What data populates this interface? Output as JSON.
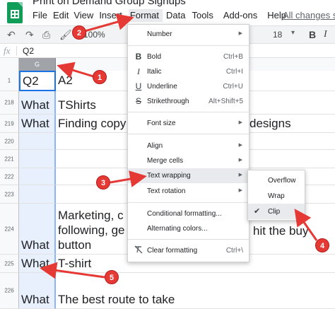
{
  "app": {
    "doc_title": "Print on Demand Group Signups",
    "save_status": "All changes sa",
    "menus": [
      {
        "label": "File",
        "active": false
      },
      {
        "label": "Edit",
        "active": false
      },
      {
        "label": "View",
        "active": false
      },
      {
        "label": "Insert",
        "active": false
      },
      {
        "label": "Format",
        "active": true
      },
      {
        "label": "Data",
        "active": false
      },
      {
        "label": "Tools",
        "active": false
      },
      {
        "label": "Add-ons",
        "active": false
      },
      {
        "label": "Help",
        "active": false
      }
    ]
  },
  "toolbar": {
    "zoom": "100%",
    "font_size": "18",
    "bold_label": "B",
    "italic_label": "I"
  },
  "formula_bar": {
    "fx": "fx",
    "value": "Q2"
  },
  "sheet": {
    "selected_column": "G",
    "rows": [
      {
        "num": "1",
        "g": "Q2",
        "h": ""
      },
      {
        "num": "218",
        "g": "What",
        "h": "TShirts"
      },
      {
        "num": "219",
        "g": "What",
        "h": "Finding copy"
      },
      {
        "num": "220",
        "g": "",
        "h": ""
      },
      {
        "num": "221",
        "g": "",
        "h": ""
      },
      {
        "num": "222",
        "g": "",
        "h": ""
      },
      {
        "num": "223",
        "g": "",
        "h": ""
      },
      {
        "num": "224",
        "g": "What",
        "h": ""
      },
      {
        "num": "225",
        "g": "What",
        "h": "T-shirt"
      },
      {
        "num": "226",
        "g": "What",
        "h": "The best route to take"
      }
    ],
    "row1_h": "A2",
    "row219_h_tail": "designs",
    "row224_lines": [
      "Marketing, c",
      "following, ge",
      "button"
    ],
    "row224_tail": "hit the buy"
  },
  "format_menu": {
    "number": "Number",
    "bold": "Bold",
    "bold_shortcut": "Ctrl+B",
    "italic": "Italic",
    "italic_shortcut": "Ctrl+I",
    "underline": "Underline",
    "underline_shortcut": "Ctrl+U",
    "strikethrough": "Strikethrough",
    "strikethrough_shortcut": "Alt+Shift+5",
    "font_size": "Font size",
    "align": "Align",
    "merge_cells": "Merge cells",
    "text_wrapping": "Text wrapping",
    "text_rotation": "Text rotation",
    "conditional_formatting": "Conditional formatting...",
    "alternating_colors": "Alternating colors...",
    "clear_formatting": "Clear formatting",
    "clear_formatting_shortcut": "Ctrl+\\"
  },
  "wrap_submenu": {
    "overflow": "Overflow",
    "wrap": "Wrap",
    "clip": "Clip",
    "checked": "Clip"
  },
  "annotations": {
    "badges": [
      "1",
      "2",
      "3",
      "4",
      "5"
    ],
    "color": "#e53935"
  }
}
